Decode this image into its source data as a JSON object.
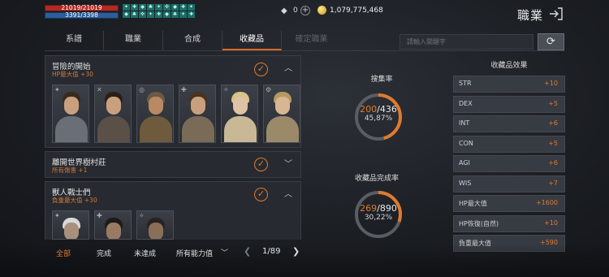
{
  "topbar": {
    "hp": "21019/21019",
    "mp": "3391/3398",
    "buffs": [
      "✦",
      "✚",
      "◆",
      "♣",
      "✦",
      "✜",
      "◆",
      "✚",
      "✦",
      "◆",
      "♣",
      "✜",
      "✦",
      "✚",
      "◆",
      "♣",
      "✦",
      "✚"
    ],
    "gems": "0",
    "gold": "1,079,775,468",
    "title": "職業"
  },
  "tabs": [
    {
      "label": "系譜"
    },
    {
      "label": "職業"
    },
    {
      "label": "合成"
    },
    {
      "label": "收藏品"
    },
    {
      "label": "確定職業"
    }
  ],
  "search": {
    "placeholder": "請輸入關鍵字"
  },
  "cards": [
    {
      "title": "冒險的開始",
      "sub": "HP最大值 +30"
    },
    {
      "title": "離開世界樹村莊",
      "sub": "所有傷害 +1"
    },
    {
      "title": "獸人戰士們",
      "sub": "負重最大值 +30"
    }
  ],
  "stats": {
    "collect_label": "搜集率",
    "collect_cur": "200",
    "collect_total": "/436",
    "collect_pct": "45,87%",
    "collect_frac": 0.4587,
    "complete_label": "收藏品完成率",
    "complete_cur": "269",
    "complete_total": "/890",
    "complete_pct": "30,22%",
    "complete_frac": 0.3022
  },
  "effects": {
    "title": "收藏品效果",
    "rows": [
      {
        "name": "STR",
        "value": "+10"
      },
      {
        "name": "DEX",
        "value": "+5"
      },
      {
        "name": "INT",
        "value": "+6"
      },
      {
        "name": "CON",
        "value": "+5"
      },
      {
        "name": "AGI",
        "value": "+6"
      },
      {
        "name": "WIS",
        "value": "+7"
      },
      {
        "name": "HP最大值",
        "value": "+1600"
      },
      {
        "name": "HP恢復(自然)",
        "value": "+10"
      },
      {
        "name": "負重最大值",
        "value": "+590"
      }
    ]
  },
  "bottom": {
    "filters": [
      "全部",
      "完成",
      "未達成",
      "所有能力值"
    ],
    "page": "1/89"
  },
  "colors": {
    "accent": "#e07a2c",
    "hp": "#b12a22",
    "mp": "#2b5e9a"
  }
}
